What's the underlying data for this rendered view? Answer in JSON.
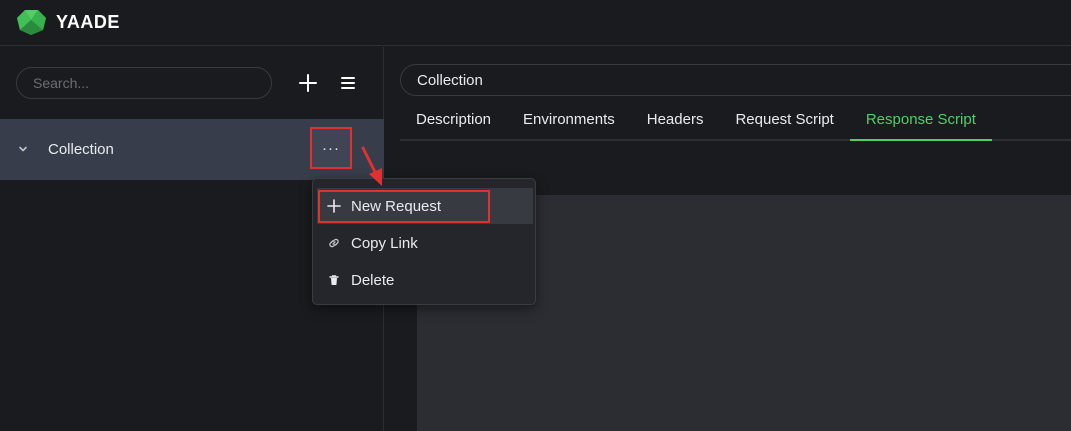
{
  "app": {
    "brand": "YAADE",
    "accent_color": "#51cf66",
    "logo_icon": "gem-logo-icon"
  },
  "sidebar": {
    "search_placeholder": "Search...",
    "add_icon": "plus-icon",
    "menu_icon": "hamburger-icon",
    "collection": {
      "label": "Collection",
      "expand_icon": "chevron-down-icon",
      "actions_label": "···"
    }
  },
  "main": {
    "title_value": "Collection",
    "tabs": [
      {
        "label": "Description",
        "active": false
      },
      {
        "label": "Environments",
        "active": false
      },
      {
        "label": "Headers",
        "active": false
      },
      {
        "label": "Request Script",
        "active": false
      },
      {
        "label": "Response Script",
        "active": true
      }
    ]
  },
  "context_menu": {
    "items": [
      {
        "label": "New Request",
        "icon": "plus-icon"
      },
      {
        "label": "Copy Link",
        "icon": "link-icon"
      },
      {
        "label": "Delete",
        "icon": "trash-icon"
      }
    ]
  },
  "annotations": {
    "highlight_color": "#e03131"
  }
}
